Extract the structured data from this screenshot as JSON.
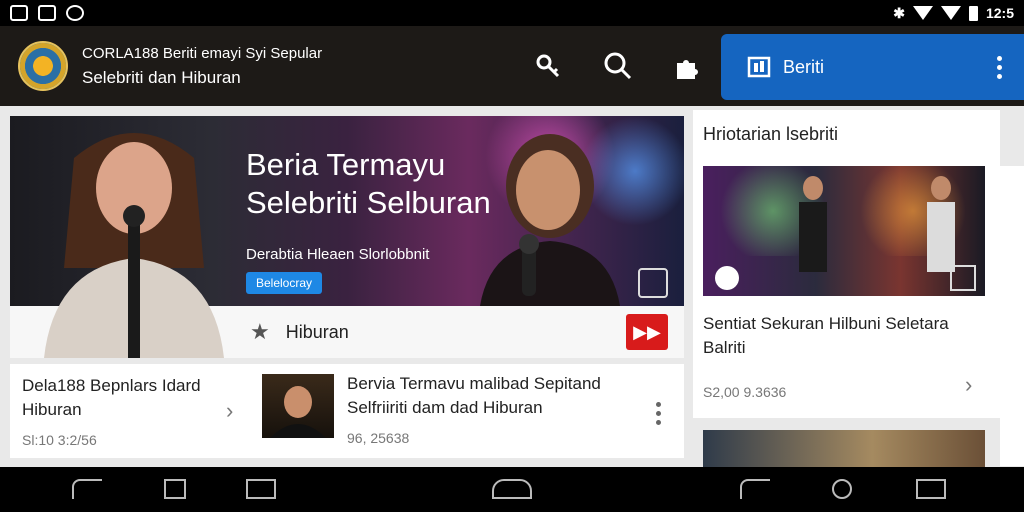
{
  "status_bar": {
    "time": "12:5"
  },
  "app_bar": {
    "title_line1": "CORLA188 Beriti emayi Syi Sepular",
    "title_line2": "Selebriti dan Hiburan",
    "berita_button_label": "Beriti",
    "accent_color": "#1565c0"
  },
  "hero": {
    "title_line1": "Beria Termayu",
    "title_line2": "Selebriti Selburan",
    "subtitle": "Derabtia Hleaen Slorlobbnit",
    "tag": "Belelocray",
    "category_label": "Hiburan"
  },
  "list": {
    "left": {
      "title_line1": "Dela188 Bepnlars Idard",
      "title_line2": "Hiburan",
      "meta": "Sl:10 3:2/56"
    },
    "right": {
      "title_line1": "Bervia Termavu malibad Sepitand",
      "title_line2": "Selfriiriti dam dad Hiburan",
      "meta": "96, 25638"
    }
  },
  "sidebar": {
    "title": "Hriotarian lsebriti",
    "caption_line1": "Sentiat Sekuran Hilbuni Seletara",
    "caption_line2": "Balriti",
    "meta": "S2,00 9.3636"
  }
}
